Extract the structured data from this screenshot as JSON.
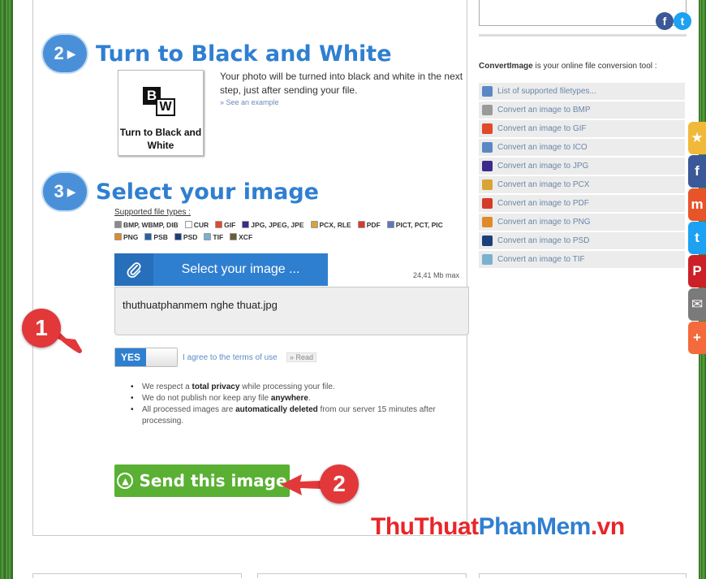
{
  "step2": {
    "number": "2",
    "title": "Turn to Black and White",
    "thumbnail_label": "Turn to Black and White",
    "description": "Your photo will be turned into black and white in the next step, just after sending your file.",
    "see_example": "» See an example"
  },
  "step3": {
    "number": "3",
    "title": "Select your image",
    "supported_title": "Supported file types :",
    "filetypes": [
      {
        "label": "BMP, WBMP, DIB",
        "color": "#8a8a8a"
      },
      {
        "label": "CUR",
        "color": "#ffffff"
      },
      {
        "label": "GIF",
        "color": "#e0492a"
      },
      {
        "label": "JPG, JPEG, JPE",
        "color": "#3b2b8a"
      },
      {
        "label": "PCX, RLE",
        "color": "#d8a437"
      },
      {
        "label": "PDF",
        "color": "#d63a2a"
      },
      {
        "label": "PICT, PCT, PIC",
        "color": "#5a7ab8"
      },
      {
        "label": "PNG",
        "color": "#e08a2a"
      },
      {
        "label": "PSB",
        "color": "#2a5fa8"
      },
      {
        "label": "PSD",
        "color": "#1b3f7a"
      },
      {
        "label": "TIF",
        "color": "#7ab0d0"
      },
      {
        "label": "XCF",
        "color": "#6b5a3a"
      }
    ],
    "select_button_label": "Select your image ...",
    "max_size": "24,41 Mb max",
    "selected_file": "thuthuatphanmem nghe thuat.jpg",
    "toggle_label": "YES",
    "agree_text": "I agree to the terms of use",
    "read_link": "» Read",
    "privacy_notes": [
      {
        "pre": "We respect a ",
        "bold": "total privacy",
        "post": " while processing your file."
      },
      {
        "pre": "We do not publish nor keep any file ",
        "bold": "anywhere",
        "post": "."
      },
      {
        "pre": "All processed images are ",
        "bold": "automatically deleted",
        "post": " from our server 15 minutes after processing."
      }
    ],
    "send_button_label": "Send this image"
  },
  "annotations": {
    "badge1": "1",
    "badge2": "2",
    "color": "#e2383a"
  },
  "sidebar": {
    "intro_brand": "ConvertImage",
    "intro_rest": " is your online file conversion tool :",
    "links": [
      {
        "label": "List of supported filetypes...",
        "color": "#5b87c5"
      },
      {
        "label": "Convert an image to BMP",
        "color": "#9a9a9a"
      },
      {
        "label": "Convert an image to GIF",
        "color": "#e0492a"
      },
      {
        "label": "Convert an image to ICO",
        "color": "#5b87c5"
      },
      {
        "label": "Convert an image to JPG",
        "color": "#3b2b8a"
      },
      {
        "label": "Convert an image to PCX",
        "color": "#d8a437"
      },
      {
        "label": "Convert an image to PDF",
        "color": "#d63a2a"
      },
      {
        "label": "Convert an image to PNG",
        "color": "#e08a2a"
      },
      {
        "label": "Convert an image to PSD",
        "color": "#1b3f7a"
      },
      {
        "label": "Convert an image to TIF",
        "color": "#7ab0d0"
      }
    ]
  },
  "social_top": [
    {
      "glyph": "f",
      "color": "#3b5998"
    },
    {
      "glyph": "t",
      "color": "#1da1f2"
    }
  ],
  "share_bar": [
    {
      "glyph": "★",
      "color": "#f0b93a"
    },
    {
      "glyph": "f",
      "color": "#3b5998"
    },
    {
      "glyph": "m",
      "color": "#e8542a"
    },
    {
      "glyph": "t",
      "color": "#1da1f2"
    },
    {
      "glyph": "P",
      "color": "#cb2027"
    },
    {
      "glyph": "✉",
      "color": "#7a7a7a"
    },
    {
      "glyph": "+",
      "color": "#f46a3c"
    }
  ],
  "watermark": {
    "part1": "ThuThuat",
    "part2": "PhanMem",
    "part3": ".vn"
  }
}
